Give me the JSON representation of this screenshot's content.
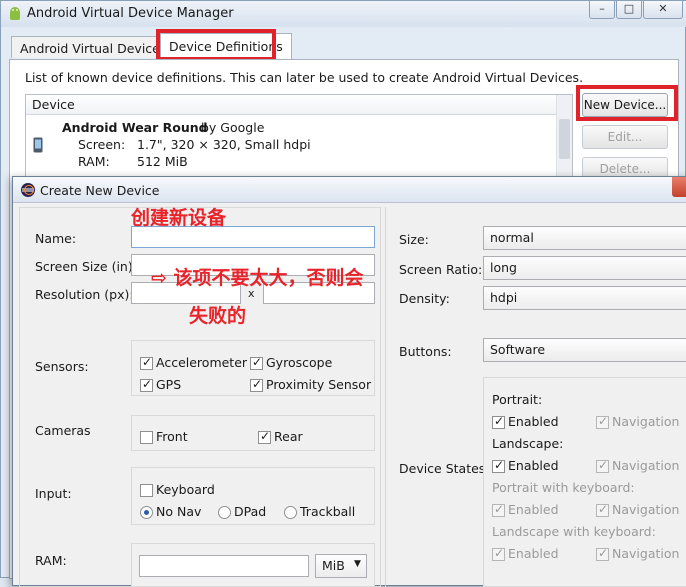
{
  "avd_manager": {
    "title": "Android Virtual Device Manager",
    "window_buttons": [
      "–",
      "□",
      "✕"
    ],
    "tabs": [
      "Android Virtual Devices",
      "Device Definitions"
    ],
    "description": "List of known device definitions. This can later be used to create Android Virtual Devices.",
    "table_header": "Device",
    "device": {
      "name": "Android Wear Round",
      "vendor": "by Google",
      "screen_label": "Screen:",
      "screen_value": "1.7\", 320 × 320, Small hdpi",
      "ram_label": "RAM:",
      "ram_value": "512 MiB"
    },
    "buttons": {
      "new_device": "New Device...",
      "edit": "Edit...",
      "delete": "Delete..."
    }
  },
  "dialog": {
    "title": "Create New Device",
    "labels": {
      "name": "Name:",
      "screen_size": "Screen Size (in):",
      "resolution": "Resolution (px):",
      "resolution_x": "x",
      "sensors": "Sensors:",
      "cameras": "Cameras",
      "input": "Input:",
      "ram": "RAM:",
      "size": "Size:",
      "screen_ratio": "Screen Ratio:",
      "density": "Density:",
      "buttons": "Buttons:",
      "device_states": "Device States:"
    },
    "values": {
      "size": "normal",
      "screen_ratio": "long",
      "density": "hdpi",
      "buttons": "Software",
      "ram_unit": "MiB"
    },
    "sensors": [
      "Accelerometer",
      "Gyroscope",
      "GPS",
      "Proximity Sensor"
    ],
    "cameras": [
      "Front",
      "Rear"
    ],
    "input": {
      "keyboard": "Keyboard",
      "nav_options": [
        "No Nav",
        "DPad",
        "Trackball"
      ]
    },
    "device_states": {
      "portrait": "Portrait:",
      "landscape": "Landscape:",
      "portrait_keyboard": "Portrait with keyboard:",
      "landscape_keyboard": "Landscape with keyboard:",
      "enabled": "Enabled",
      "navigation": "Navigation"
    }
  },
  "annotations": {
    "create_new_device": "创建新设备",
    "screen_warning_line1": "⇨ 该项不要太大，否则会",
    "screen_warning_line2": "失败的"
  },
  "colors": {
    "annotation": "#e8232a",
    "highlight_box": "#e0232b"
  },
  "icons": {
    "app": "android-robot-icon",
    "device": "phone-icon",
    "dialog": "eclipse-icon"
  }
}
